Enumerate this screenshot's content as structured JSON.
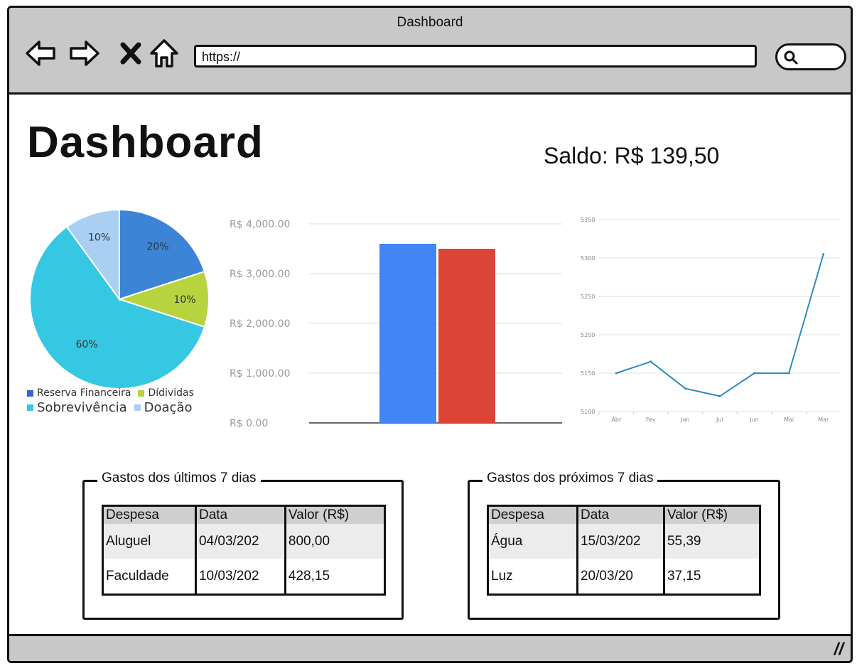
{
  "window": {
    "title": "Dashboard"
  },
  "browser": {
    "url": "https://",
    "icons": [
      "back-arrow-icon",
      "forward-arrow-icon",
      "close-x-icon",
      "home-icon",
      "search-icon"
    ]
  },
  "page": {
    "title": "Dashboard",
    "saldo": "Saldo: R$ 139,50"
  },
  "colors": {
    "reserva": "#3c85d6",
    "dividas": "#b7d33d",
    "sobrevivencia": "#36c8e3",
    "doacao": "#a9cff3",
    "bar_blue": "#4285f4",
    "bar_red": "#db4437",
    "line": "#2e8bc0"
  },
  "legend": [
    {
      "label": "Reserva Financeira",
      "color": "#3366cc"
    },
    {
      "label": "Dídividas",
      "color": "#b7d33d"
    },
    {
      "label": "Sobrevivência",
      "color": "#36c8e3"
    },
    {
      "label": "Doação",
      "color": "#a9cff3"
    }
  ],
  "chart_data": [
    {
      "type": "pie",
      "slices": [
        {
          "label": "Reserva Financeira",
          "value": 20,
          "display": "20%",
          "color": "#3c85d6"
        },
        {
          "label": "Dídividas",
          "value": 10,
          "display": "10%",
          "color": "#b7d33d"
        },
        {
          "label": "Sobrevivência",
          "value": 60,
          "display": "60%",
          "color": "#36c8e3"
        },
        {
          "label": "Doação",
          "value": 10,
          "display": "10%",
          "color": "#a9cff3"
        }
      ]
    },
    {
      "type": "bar",
      "series": [
        {
          "values": [
            3600
          ],
          "color": "#4285f4"
        },
        {
          "values": [
            3500
          ],
          "color": "#db4437"
        }
      ],
      "ylim": [
        0,
        4000
      ],
      "yticks": [
        "R$ 0.00",
        "R$ 1,000.00",
        "R$ 2,000.00",
        "R$ 3,000.00",
        "R$ 4,000.00"
      ],
      "grid": true
    },
    {
      "type": "line",
      "categories": [
        "Abr",
        "Fev",
        "Jan",
        "Jul",
        "Jun",
        "Mai",
        "Mar"
      ],
      "values": [
        5150,
        5165,
        5130,
        5120,
        5150,
        5150,
        5305
      ],
      "ylim": [
        5100,
        5350
      ],
      "yticks": [
        "5100",
        "5150",
        "5200",
        "5250",
        "5300",
        "5350"
      ],
      "color": "#2e8bc0",
      "grid": true
    }
  ],
  "tables": {
    "last7": {
      "title": "Gastos dos últimos 7 dias",
      "headers": [
        "Despesa",
        "Data",
        "Valor (R$)"
      ],
      "rows": [
        [
          "Aluguel",
          "04/03/202",
          "800,00"
        ],
        [
          "Faculdade",
          "10/03/202",
          "428,15"
        ]
      ]
    },
    "next7": {
      "title": "Gastos dos próximos 7 dias",
      "headers": [
        "Despesa",
        "Data",
        "Valor (R$)"
      ],
      "rows": [
        [
          "Água",
          "15/03/202",
          "55,39"
        ],
        [
          "Luz",
          "20/03/20",
          "37,15"
        ]
      ]
    }
  },
  "statusbar": {
    "grip": "//"
  }
}
